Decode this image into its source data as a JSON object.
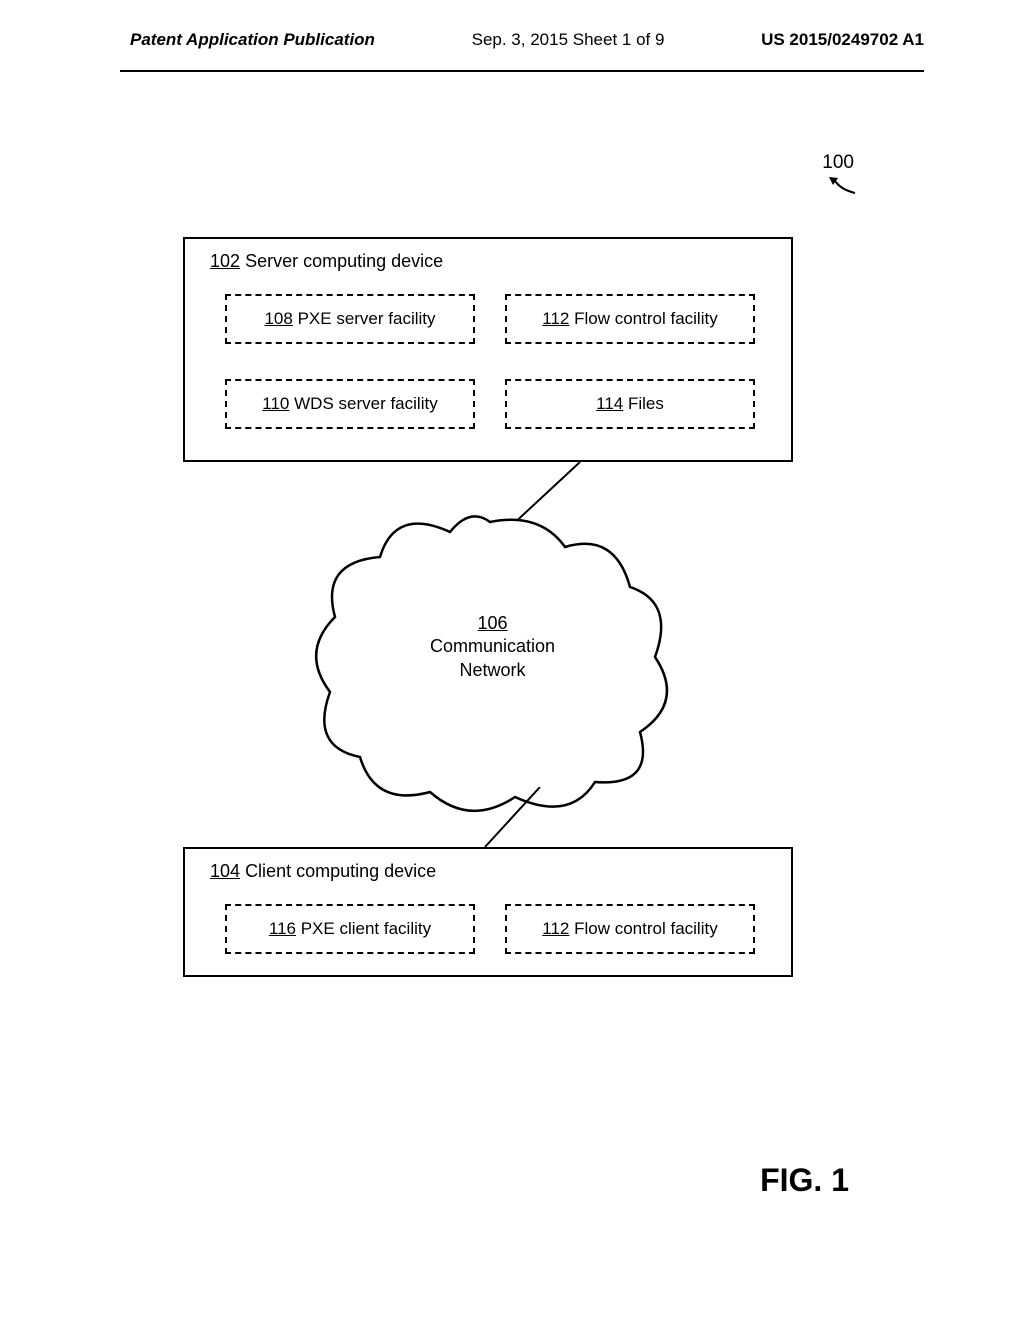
{
  "header": {
    "left": "Patent Application Publication",
    "center": "Sep. 3, 2015  Sheet 1 of 9",
    "right": "US 2015/0249702 A1"
  },
  "diagram": {
    "ref_num": "100",
    "server": {
      "num": "102",
      "title": "Server computing device",
      "boxes": [
        {
          "num": "108",
          "label": "PXE server facility"
        },
        {
          "num": "112",
          "label": "Flow control facility"
        },
        {
          "num": "110",
          "label": "WDS server facility"
        },
        {
          "num": "114",
          "label": "Files"
        }
      ]
    },
    "cloud": {
      "num": "106",
      "label_l1": "Communication",
      "label_l2": "Network"
    },
    "client": {
      "num": "104",
      "title": "Client computing device",
      "boxes": [
        {
          "num": "116",
          "label": "PXE client facility"
        },
        {
          "num": "112",
          "label": "Flow control facility"
        }
      ]
    },
    "fig_label": "FIG. 1"
  }
}
